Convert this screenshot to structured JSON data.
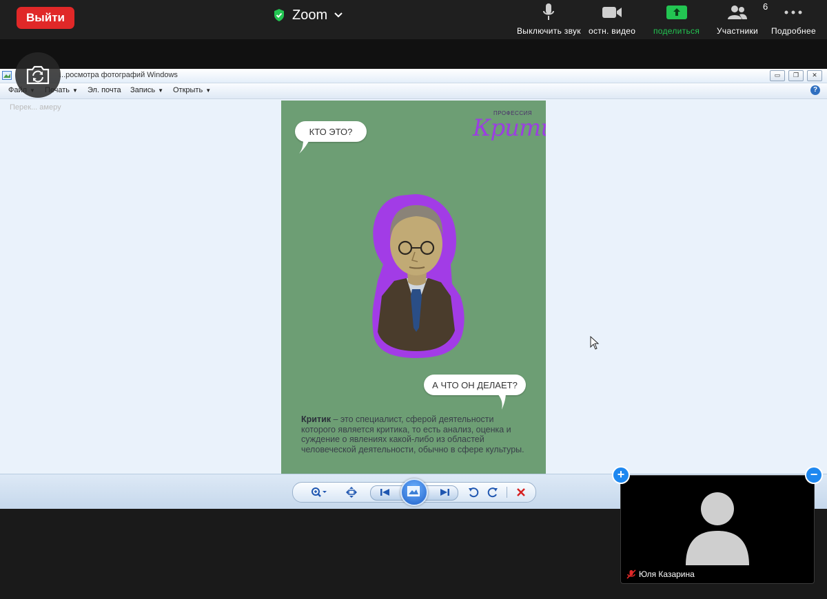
{
  "zoom": {
    "leave_label": "Выйти",
    "title": "Zoom",
    "participants_count": "6",
    "toolbar": {
      "mute_label": "Выключить звук",
      "video_label": "остн. видео",
      "share_label": "поделиться",
      "participants_label": "Участники",
      "more_label": "Подробнее"
    },
    "switch_camera_label": "Перек... амеру"
  },
  "viewer": {
    "window_title": "...росмотра фотографий Windows",
    "menu": [
      "Файл",
      "Печать",
      "Эл. почта",
      "Запись",
      "Открыть"
    ],
    "help": "?"
  },
  "poster": {
    "profession_label": "ПРОФЕССИЯ",
    "title": "Критик",
    "bubble_question_1": "КТО ЭТО?",
    "bubble_question_2": "А ЧТО ОН ДЕЛАЕТ?",
    "description_term": "Критик",
    "description_text": " – это специалист, сферой деятельности которого является критика, то есть анализ, оценка и суждение о явлениях какой-либо из областей человеческой деятельности, обычно в сфере культуры."
  },
  "participant": {
    "name": "Юля Казарина"
  },
  "colors": {
    "leave": "#e02828",
    "share_green": "#23c552",
    "poster_bg": "#6d9e74",
    "brand_purple": "#9b3fe0",
    "zoom_blue": "#1e88f0"
  }
}
